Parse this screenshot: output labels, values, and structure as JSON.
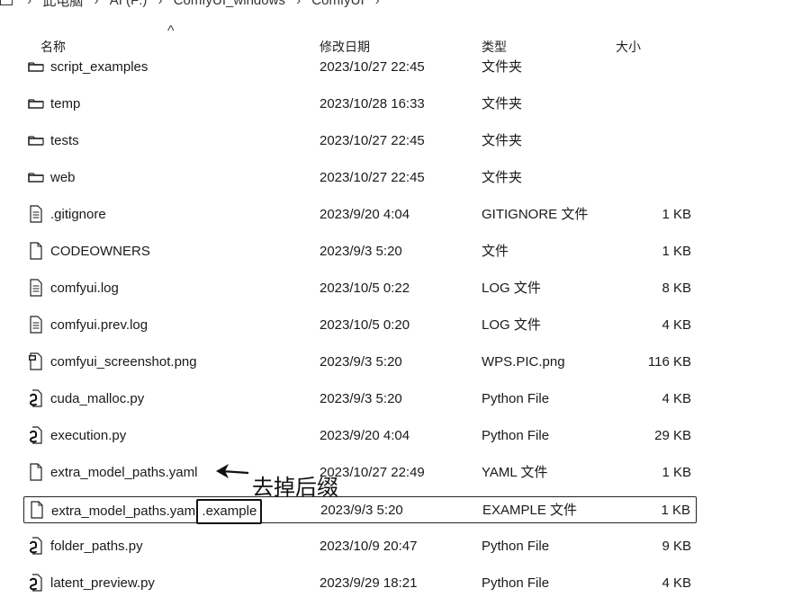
{
  "breadcrumb": {
    "items": [
      "此电脑",
      "AI (F:)",
      "ComfyUI_windows",
      "ComfyUI"
    ]
  },
  "columns": {
    "name": "名称",
    "date": "修改日期",
    "type": "类型",
    "size": "大小",
    "sort_indicator": "^"
  },
  "files": [
    {
      "name": "script_examples",
      "date": "2023/10/27 22:45",
      "type": "文件夹",
      "size": "",
      "icon": "folder-icon"
    },
    {
      "name": "temp",
      "date": "2023/10/28 16:33",
      "type": "文件夹",
      "size": "",
      "icon": "folder-icon"
    },
    {
      "name": "tests",
      "date": "2023/10/27 22:45",
      "type": "文件夹",
      "size": "",
      "icon": "folder-icon"
    },
    {
      "name": "web",
      "date": "2023/10/27 22:45",
      "type": "文件夹",
      "size": "",
      "icon": "folder-icon"
    },
    {
      "name": ".gitignore",
      "date": "2023/9/20 4:04",
      "type": "GITIGNORE 文件",
      "size": "1 KB",
      "icon": "text-file-icon"
    },
    {
      "name": "CODEOWNERS",
      "date": "2023/9/3 5:20",
      "type": "文件",
      "size": "1 KB",
      "icon": "blank-file-icon"
    },
    {
      "name": "comfyui.log",
      "date": "2023/10/5 0:22",
      "type": "LOG 文件",
      "size": "8 KB",
      "icon": "text-file-icon"
    },
    {
      "name": "comfyui.prev.log",
      "date": "2023/10/5 0:20",
      "type": "LOG 文件",
      "size": "4 KB",
      "icon": "text-file-icon"
    },
    {
      "name": "comfyui_screenshot.png",
      "date": "2023/9/3 5:20",
      "type": "WPS.PIC.png",
      "size": "116 KB",
      "icon": "image-file-icon"
    },
    {
      "name": "cuda_malloc.py",
      "date": "2023/9/3 5:20",
      "type": "Python File",
      "size": "4 KB",
      "icon": "python-file-icon"
    },
    {
      "name": "execution.py",
      "date": "2023/9/20 4:04",
      "type": "Python File",
      "size": "29 KB",
      "icon": "python-file-icon"
    },
    {
      "name": "extra_model_paths.yaml",
      "date": "2023/10/27 22:49",
      "type": "YAML 文件",
      "size": "1 KB",
      "icon": "blank-file-icon"
    },
    {
      "name_base": "extra_model_paths.yaml",
      "name_ext": ".example",
      "date": "2023/9/3 5:20",
      "type": "EXAMPLE 文件",
      "size": "1 KB",
      "icon": "blank-file-icon",
      "selected": true
    },
    {
      "name": "folder_paths.py",
      "date": "2023/10/9 20:47",
      "type": "Python File",
      "size": "9 KB",
      "icon": "python-file-icon"
    },
    {
      "name": "latent_preview.py",
      "date": "2023/9/29 18:21",
      "type": "Python File",
      "size": "4 KB",
      "icon": "python-file-icon"
    }
  ],
  "annotation": {
    "label": "去掉后缀"
  }
}
